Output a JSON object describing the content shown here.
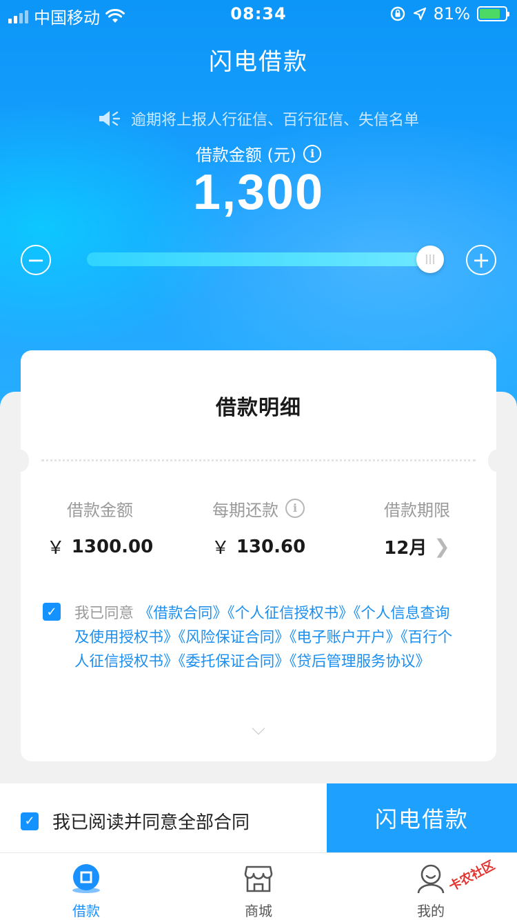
{
  "status_bar": {
    "carrier": "中国移动",
    "time": "08:34",
    "battery_percent": "81%",
    "battery_level": 0.81
  },
  "header": {
    "title": "闪电借款"
  },
  "notice": {
    "text": "逾期将上报人行征信、百行征信、失信名单"
  },
  "loan": {
    "amount_label": "借款金额 (元)",
    "amount": "1,300",
    "slider_level": 1.0,
    "minus_symbol": "−",
    "plus_symbol": "+"
  },
  "detail": {
    "title": "借款明细",
    "columns": [
      {
        "label": "借款金额",
        "value": "1300.00",
        "currency": "￥"
      },
      {
        "label": "每期还款",
        "value": "130.60",
        "currency": "￥"
      },
      {
        "label": "借款期限",
        "value": "12月"
      }
    ],
    "agreement": {
      "prefix": "我已同意",
      "links": "《借款合同》《个人征信授权书》《个人信息查询及使用授权书》《风险保证合同》《电子账户开户》《百行个人征信授权书》《委托保证合同》《贷后管理服务协议》"
    }
  },
  "action_bar": {
    "agree_all": "我已阅读并同意全部合同",
    "submit": "闪电借款"
  },
  "tabs": [
    {
      "label": "借款",
      "icon": "loan-icon",
      "active": true
    },
    {
      "label": "商城",
      "icon": "store-icon",
      "active": false
    },
    {
      "label": "我的",
      "icon": "profile-icon",
      "active": false
    }
  ],
  "watermark": "卡农社区",
  "colors": {
    "primary": "#1ea0ff",
    "link": "#1b8ff0",
    "active_tab": "#1890ff"
  }
}
